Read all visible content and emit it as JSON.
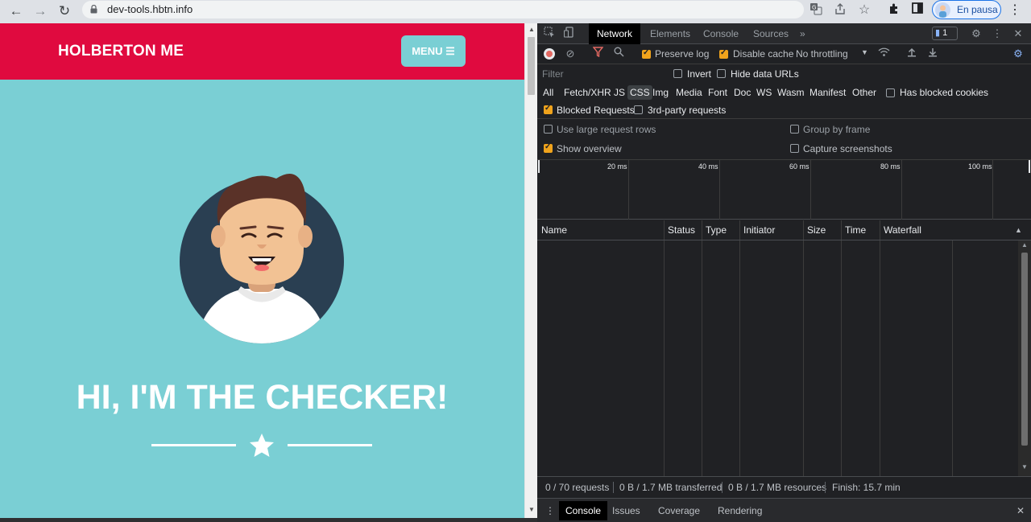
{
  "browser": {
    "url": "dev-tools.hbtn.info",
    "profile_label": "En pausa",
    "nav_back": "←",
    "nav_forward": "→",
    "nav_reload": "↻",
    "menu_icon": "⋮"
  },
  "site": {
    "logo": "HOLBERTON ME",
    "menu_label": "MENU ☰",
    "hero_title": "HI, I'M THE CHECKER!",
    "colors": {
      "header": "#e00a3f",
      "background": "#7acfd4"
    }
  },
  "devtools": {
    "tabs": [
      "Network",
      "Elements",
      "Console",
      "Sources"
    ],
    "more_tabs": "»",
    "issues_badge": "1",
    "toolbar": {
      "preserve_log": "Preserve log",
      "disable_cache": "Disable cache",
      "throttling": "No throttling"
    },
    "filter": {
      "placeholder": "Filter",
      "invert": "Invert",
      "hide_data_urls": "Hide data URLs"
    },
    "types": [
      "All",
      "Fetch/XHR",
      "JS",
      "CSS",
      "Img",
      "Media",
      "Font",
      "Doc",
      "WS",
      "Wasm",
      "Manifest",
      "Other"
    ],
    "active_type": "CSS",
    "has_blocked_cookies": "Has blocked cookies",
    "blocked_requests": "Blocked Requests",
    "third_party": "3rd-party requests",
    "settings": {
      "large_rows": "Use large request rows",
      "group_by_frame": "Group by frame",
      "show_overview": "Show overview",
      "capture_screenshots": "Capture screenshots"
    },
    "overview_ticks": [
      "20 ms",
      "40 ms",
      "60 ms",
      "80 ms",
      "100 ms"
    ],
    "columns": [
      "Name",
      "Status",
      "Type",
      "Initiator",
      "Size",
      "Time",
      "Waterfall"
    ],
    "summary": {
      "requests": "0 / 70 requests",
      "transferred": "0 B / 1.7 MB transferred",
      "resources": "0 B / 1.7 MB resources",
      "finish": "Finish: 15.7 min"
    },
    "drawer_tabs": [
      "Console",
      "Issues",
      "Coverage",
      "Rendering"
    ]
  }
}
